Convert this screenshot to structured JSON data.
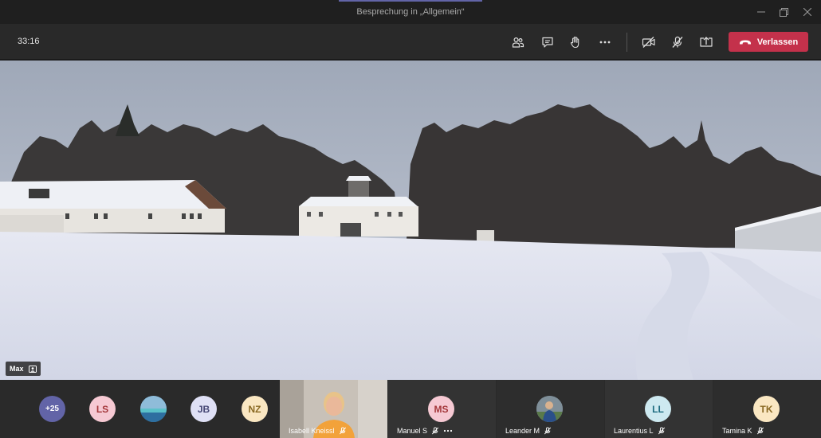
{
  "window": {
    "title": "Besprechung in „Allgemein“"
  },
  "toolbar": {
    "timer": "33:16",
    "leave_label": "Verlassen",
    "icons": [
      "participants-icon",
      "chat-icon",
      "raise-hand-icon",
      "more-options-icon",
      "camera-off-icon",
      "mic-off-icon",
      "share-screen-icon",
      "phone-hangup-icon"
    ]
  },
  "main_video": {
    "speaker": "Max"
  },
  "strip": {
    "overflow_count": "+25",
    "avatars": [
      {
        "initials": "LS",
        "bg": "#f6c9d3",
        "fg": "#a4373a"
      },
      {
        "initials": "JB",
        "bg": "#dfe0f5",
        "fg": "#464775"
      },
      {
        "initials": "NZ",
        "bg": "#fae7c2",
        "fg": "#8a6a24"
      }
    ],
    "tiles": [
      {
        "name": "Isabell Kneissl",
        "initials": ""
      },
      {
        "name": "Manuel S",
        "initials": "MS",
        "bg": "#f6c9d3",
        "fg": "#a4373a"
      },
      {
        "name": "Leander M",
        "initials": ""
      },
      {
        "name": "Laurentius L",
        "initials": "LL",
        "bg": "#cde9f0",
        "fg": "#1e6c80"
      },
      {
        "name": "Tamina K",
        "initials": "TK",
        "bg": "#fae7c2",
        "fg": "#8a6a24"
      }
    ]
  },
  "colors": {
    "accent": "#6264a7",
    "leave": "#c4314b",
    "overflow": "#6264a7"
  }
}
